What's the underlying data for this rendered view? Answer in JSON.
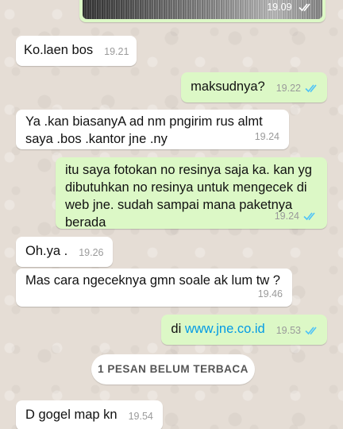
{
  "image_message": {
    "time": "19.09",
    "status_icon": "double-check-read-icon"
  },
  "messages": [
    {
      "direction": "in",
      "text": "Ko.laen bos",
      "time": "19.21"
    },
    {
      "direction": "out",
      "text": "maksudnya?",
      "time": "19.22",
      "status_icon": "double-check-read-icon"
    },
    {
      "direction": "in",
      "text": "Ya .kan biasanyA ad  nm pngirim rus almt saya .bos .kantor jne .ny",
      "time": "19.24"
    },
    {
      "direction": "out",
      "text": "itu saya fotokan no resinya saja ka. kan yg dibutuhkan no resinya untuk mengecek di web jne. sudah sampai mana paketnya berada",
      "time": "19.24",
      "status_icon": "double-check-read-icon"
    },
    {
      "direction": "in",
      "text": "Oh.ya .",
      "time": "19.26"
    },
    {
      "direction": "in",
      "text": "Mas cara ngeceknya gmn soale ak lum tw ?",
      "time": "19.46"
    },
    {
      "direction": "out",
      "text_prefix": "di ",
      "link": "www.jne.co.id",
      "time": "19.53",
      "status_icon": "double-check-read-icon"
    },
    {
      "direction": "in",
      "text": "D gogel map kn",
      "time": "19.54"
    }
  ],
  "unread_banner": "1 PESAN BELUM TERBACA",
  "colors": {
    "outgoing": "#dcf8c6",
    "incoming": "#ffffff",
    "read_ticks": "#4fc3f7",
    "link": "#039be5",
    "wallpaper": "#e5ddd5"
  }
}
